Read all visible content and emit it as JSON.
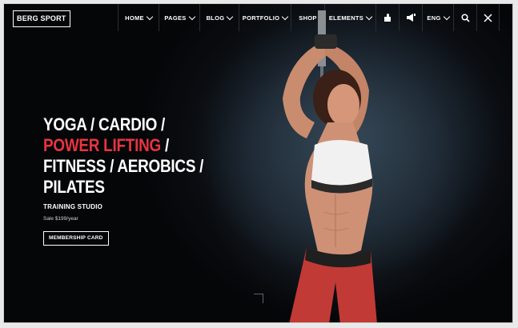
{
  "brand": {
    "logo": "BERG SPORT"
  },
  "nav": {
    "items": [
      {
        "label": "HOME",
        "dropdown": true
      },
      {
        "label": "PAGES",
        "dropdown": true
      },
      {
        "label": "BLOG",
        "dropdown": true
      },
      {
        "label": "PORTFOLIO",
        "dropdown": true
      },
      {
        "label": "SHOP",
        "dropdown": false
      },
      {
        "label": "ELEMENTS",
        "dropdown": true
      }
    ],
    "icons": [
      "puzzle-icon",
      "megaphone-icon"
    ],
    "language": "ENG",
    "search_icon": "search-icon",
    "close_icon": "close-icon"
  },
  "hero": {
    "line1": "YOGA / CARDIO /",
    "line2_highlight": "POWER LIFTING",
    "line2_rest": " /",
    "line3": "FITNESS / AEROBICS /",
    "line4": "PILATES",
    "subtitle": "TRAINING STUDIO",
    "price": "Sale $199/year",
    "button": "MEMBERSHIP CARD"
  },
  "colors": {
    "accent": "#e8343f",
    "background": "#050608",
    "text": "#ffffff"
  }
}
